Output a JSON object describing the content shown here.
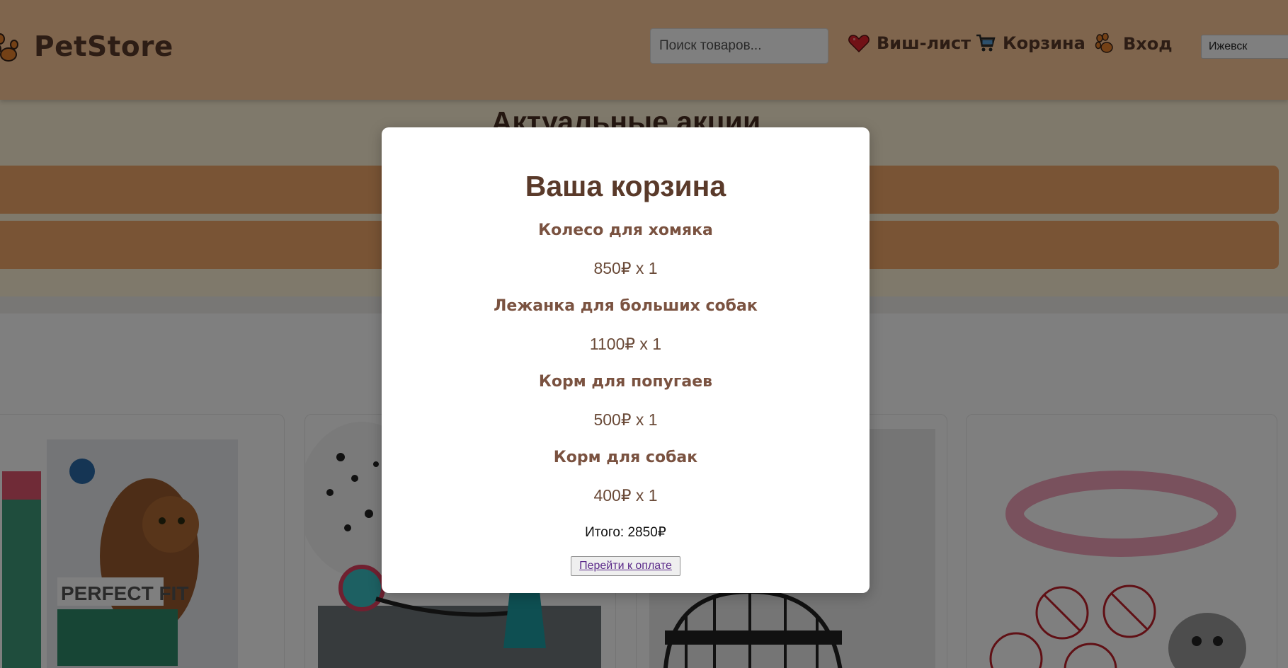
{
  "header": {
    "logo_text": "PetStore",
    "search_placeholder": "Поиск товаров...",
    "nav": {
      "wishlist": "Виш-лист",
      "cart": "Корзина",
      "login": "Вход"
    },
    "city": "Ижевск"
  },
  "page": {
    "promo_title": "Актуальные акции"
  },
  "cart_modal": {
    "title": "Ваша корзина",
    "items": [
      {
        "name": "Колесо для хомяка",
        "price_line": "850₽ x 1"
      },
      {
        "name": "Лежанка для больших собак",
        "price_line": "1100₽ x 1"
      },
      {
        "name": "Корм для попугаев",
        "price_line": "500₽ x 1"
      },
      {
        "name": "Корм для собак",
        "price_line": "400₽ x 1"
      }
    ],
    "total": "Итого: 2850₽",
    "pay_button": "Перейти к оплате"
  },
  "colors": {
    "header_bg": "#ffcb9a",
    "brand_text": "#5a3a2a",
    "promo_bar": "#f2a96a",
    "overlay": "rgba(0,0,0,0.5)"
  },
  "icons": [
    "paw-logo-icon",
    "heart-icon",
    "cart-icon",
    "paw-login-icon"
  ]
}
